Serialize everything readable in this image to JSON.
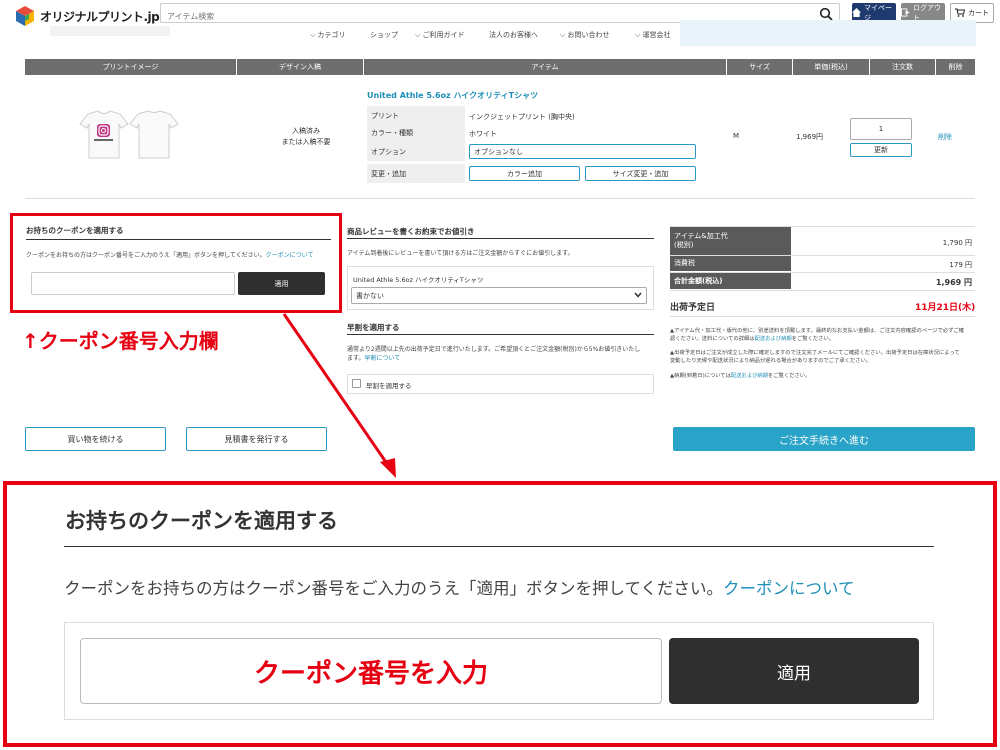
{
  "header": {
    "logo_text": "オリジナルプリント.jp",
    "search_placeholder": "アイテム検索",
    "mypage_label": "マイページ",
    "logout_label": "ログアウト",
    "cart_label": "カート"
  },
  "nav": {
    "items": [
      "カテゴリ",
      "ショップ",
      "ご利用ガイド",
      "法人のお客様へ",
      "お問い合わせ",
      "運営会社"
    ]
  },
  "table": {
    "headers": [
      "プリントイメージ",
      "デザイン入稿",
      "アイテム",
      "サイズ",
      "単価(税込)",
      "注文数",
      "削除"
    ],
    "design_status_line1": "入稿済み",
    "design_status_line2": "または入稿不要",
    "item_name": "United Athle 5.6oz ハイクオリティTシャツ",
    "spec_print_label": "プリント",
    "spec_print_value": "インクジェットプリント (胸中央)",
    "spec_color_label": "カラー・種類",
    "spec_color_value": "ホワイト",
    "spec_option_label": "オプション",
    "spec_option_value": "オプションなし",
    "spec_change_label": "変更・追加",
    "add_color_button": "カラー追加",
    "change_size_button": "サイズ変更・追加",
    "size": "M",
    "unit_price": "1,969円",
    "quantity": "1",
    "update_button": "更新",
    "delete_link": "削除"
  },
  "coupon": {
    "title": "お持ちのクーポンを適用する",
    "desc": "クーポンをお持ちの方はクーポン番号をご入力のうえ「適用」ボタンを押してください。",
    "link": "クーポンについて",
    "apply_button": "適用",
    "annotation": "↑クーポン番号入力欄",
    "zoom_placeholder": "クーポン番号を入力"
  },
  "review": {
    "title": "商品レビューを書くお約束でお値引き",
    "desc": "アイテム到着後にレビューを書いて頂ける方はご注文金額からすぐにお値引します。",
    "item_name": "United Athle 5.6oz ハイクオリティTシャツ",
    "select_value": "書かない"
  },
  "early": {
    "title": "早割を適用する",
    "desc_line1": "通常より2週間以上先の出荷予定日で進行いたします。ご希望頂くとご注文金額(税別)から5%お値引きいたし",
    "desc_line2_prefix": "ます。",
    "desc_link": "早割について",
    "checkbox_label": "早割を適用する"
  },
  "summary": {
    "item_label_line1": "アイテム&加工代",
    "item_label_line2": "(税別)",
    "item_value": "1,790 円",
    "tax_label": "消費税",
    "tax_value": "179 円",
    "total_label": "合計金額(税込)",
    "total_value": "1,969 円",
    "ship_label": "出荷予定日",
    "ship_date": "11月21日(木)",
    "note1_line1": "▲アイテム代・加工代・版代の他に、別途送料を頂戴します。最終的なお支払い金額は、ご注文内容確認のページで必ずご確",
    "note1_line2_prefix": "認ください。送料についての詳細は",
    "note1_link": "配送および納期",
    "note1_line2_suffix": "をご覧ください。",
    "note2_line1": "▲出荷予定日はご注文が成立した際に確定しますので注文完了メールにてご確認ください。出荷予定日は在庫状況によって",
    "note2_line2": "変動したり天候や配送状況により納品が遅れる場合がありますのでご了承ください。",
    "note3_prefix": "▲納期(到着日)については",
    "note3_link": "配送および納期",
    "note3_suffix": "をご覧ください。"
  },
  "buttons": {
    "continue_shopping": "買い物を続ける",
    "issue_quote": "見積書を発行する",
    "checkout": "ご注文手続きへ進む"
  },
  "colors": {
    "accent_blue": "#2aa3c8",
    "alert_red": "#e60012",
    "dark_button": "#2f2f2f",
    "header_gray": "#6e6e6e",
    "navy": "#1e3a6e"
  }
}
